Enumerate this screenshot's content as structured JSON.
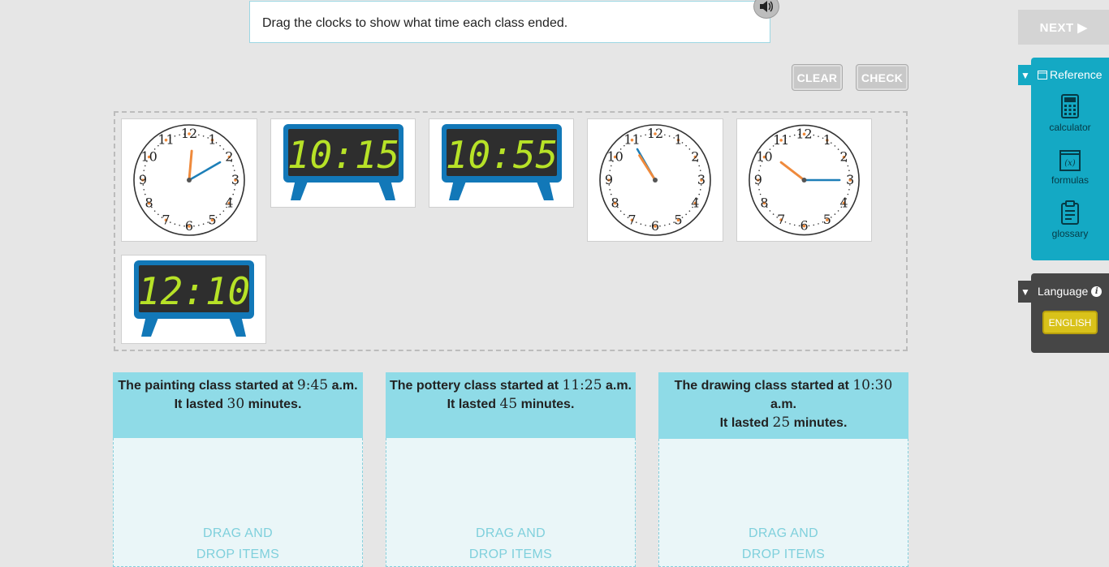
{
  "prompt": {
    "text": "Drag the clocks to show what time each class ended."
  },
  "buttons": {
    "clear": "CLEAR",
    "check": "CHECK",
    "next": "NEXT ▶"
  },
  "colors": {
    "accent": "#14a9c4",
    "zone_header": "#8fdbe7",
    "language_active": "#d9c21a",
    "digital_body": "#1278b8",
    "digital_digits": "#b7e227",
    "hour_hand": "#ef8a3c",
    "minute_hand": "#1d7fb8"
  },
  "bank": {
    "items": [
      {
        "type": "analog",
        "hour": 12,
        "minute": 10
      },
      {
        "type": "digital",
        "hour": "10",
        "minute": "15"
      },
      {
        "type": "digital",
        "hour": "10",
        "minute": "55"
      },
      {
        "type": "analog",
        "hour": 10,
        "minute": 55
      },
      {
        "type": "analog",
        "hour": 10,
        "minute": 15
      },
      {
        "type": "digital",
        "hour": "12",
        "minute": "10"
      }
    ]
  },
  "zones": [
    {
      "line1": "The painting class started at",
      "start": "9:45",
      "suffix": "a.m.",
      "line2a": "It lasted",
      "duration": "30",
      "line2b": "minutes.",
      "drop": [
        "DRAG AND",
        "DROP ITEMS"
      ]
    },
    {
      "line1": "The pottery class started at",
      "start": "11:25",
      "suffix": "a.m.",
      "line2a": "It lasted",
      "duration": "45",
      "line2b": "minutes.",
      "drop": [
        "DRAG AND",
        "DROP ITEMS"
      ]
    },
    {
      "line1": "The drawing class started at",
      "start": "10:30",
      "suffix": "a.m.",
      "line2a": "It lasted",
      "duration": "25",
      "line2b": "minutes.",
      "drop": [
        "DRAG AND",
        "DROP ITEMS"
      ]
    }
  ],
  "reference": {
    "toggle": "▼",
    "title": "Reference",
    "items": [
      {
        "label": "calculator",
        "icon": "calculator-icon"
      },
      {
        "label": "formulas",
        "icon": "formulas-icon"
      },
      {
        "label": "glossary",
        "icon": "clipboard-icon"
      }
    ]
  },
  "language": {
    "toggle": "▼",
    "title": "Language",
    "info": "i",
    "selected": "ENGLISH"
  }
}
